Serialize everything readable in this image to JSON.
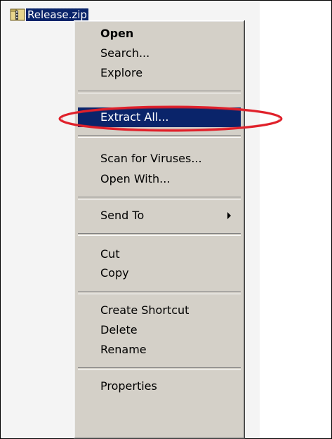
{
  "file": {
    "name": "Release.zip",
    "icon": "zip-folder-icon"
  },
  "menu": {
    "items": [
      {
        "key": "open",
        "label": "Open",
        "bold": true
      },
      {
        "key": "search",
        "label": "Search..."
      },
      {
        "key": "explore",
        "label": "Explore"
      },
      {
        "key": "extract-all",
        "label": "Extract All...",
        "highlighted": true
      },
      {
        "key": "scan-for-viruses",
        "label": "Scan for Viruses..."
      },
      {
        "key": "open-with",
        "label": "Open With..."
      },
      {
        "key": "send-to",
        "label": "Send To",
        "submenu": true
      },
      {
        "key": "cut",
        "label": "Cut"
      },
      {
        "key": "copy",
        "label": "Copy"
      },
      {
        "key": "create-shortcut",
        "label": "Create Shortcut"
      },
      {
        "key": "delete",
        "label": "Delete"
      },
      {
        "key": "rename",
        "label": "Rename"
      },
      {
        "key": "properties",
        "label": "Properties"
      }
    ]
  },
  "colors": {
    "selection": "#0a246a",
    "annotation": "#e0202a",
    "menu_face": "#d4d0c8"
  }
}
